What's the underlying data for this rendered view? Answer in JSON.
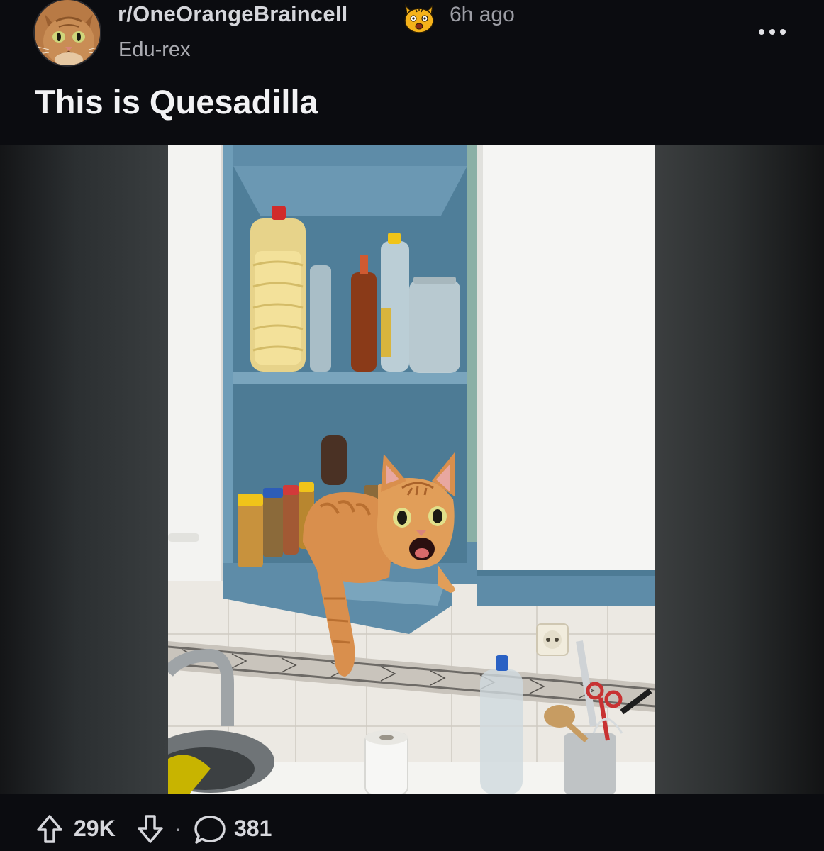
{
  "post": {
    "community": "r/OneOrangeBraincell",
    "age": "6h ago",
    "author": "Edu-rex",
    "title": "This is Quesadilla"
  },
  "actions": {
    "upvotes": "29K",
    "separator": "·",
    "comments": "381"
  },
  "icons": {
    "avatar": "cat-avatar",
    "flair": "cat-face-icon",
    "more": "more-options-icon",
    "upvote": "upvote-arrow-icon",
    "downvote": "downvote-arrow-icon",
    "comment": "comment-bubble-icon"
  },
  "colors": {
    "background": "#0b0c10",
    "flair": "#f5b21a",
    "cabinet": "#5e8ca8",
    "cat": "#d98f4d"
  }
}
